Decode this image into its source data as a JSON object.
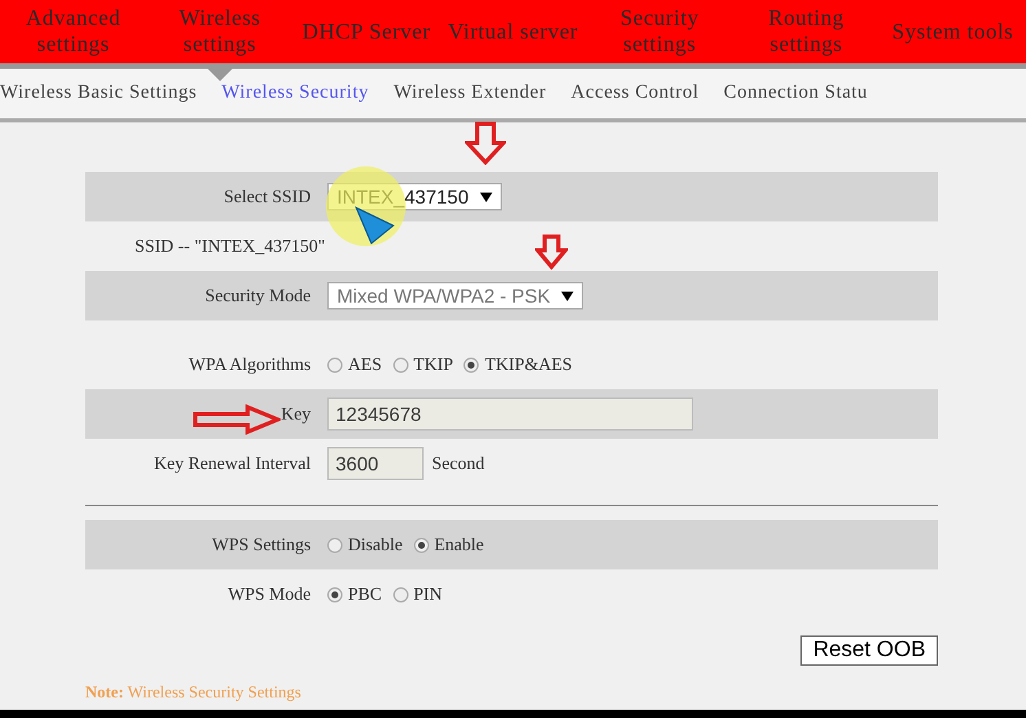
{
  "nav": [
    {
      "label": "Advanced settings",
      "selected": false
    },
    {
      "label": "Wireless settings",
      "selected": true
    },
    {
      "label": "DHCP Server",
      "selected": false
    },
    {
      "label": "Virtual server",
      "selected": false
    },
    {
      "label": "Security settings",
      "selected": false
    },
    {
      "label": "Routing settings",
      "selected": false
    },
    {
      "label": "System tools",
      "selected": false
    }
  ],
  "subnav": [
    {
      "label": "Wireless Basic Settings",
      "selected": false
    },
    {
      "label": "Wireless Security",
      "selected": true
    },
    {
      "label": "Wireless Extender",
      "selected": false
    },
    {
      "label": "Access Control",
      "selected": false
    },
    {
      "label": "Connection Statu",
      "selected": false
    }
  ],
  "form": [
    {
      "kind": "select",
      "label": "Select SSID",
      "value": "INTEX_437150",
      "shaded": true
    },
    {
      "kind": "text",
      "text": "SSID -- \"INTEX_437150\"",
      "shaded": false
    },
    {
      "kind": "select",
      "label": "Security Mode",
      "value": "Mixed WPA/WPA2 - PSK",
      "shaded": true
    },
    {
      "kind": "spacer"
    },
    {
      "kind": "radio",
      "label": "WPA Algorithms",
      "shaded": false,
      "options": [
        {
          "label": "AES",
          "selected": false
        },
        {
          "label": "TKIP",
          "selected": false
        },
        {
          "label": "TKIP&AES",
          "selected": true
        }
      ]
    },
    {
      "kind": "field",
      "label": "Key",
      "value": "12345678",
      "shaded": true
    },
    {
      "kind": "field",
      "label": "Key Renewal Interval",
      "value": "3600",
      "unit": "Second",
      "shaded": false
    },
    {
      "kind": "divider"
    },
    {
      "kind": "radio",
      "label": "WPS Settings",
      "shaded": true,
      "options": [
        {
          "label": "Disable",
          "selected": false
        },
        {
          "label": "Enable",
          "selected": true
        }
      ]
    },
    {
      "kind": "radio",
      "label": "WPS Mode",
      "shaded": false,
      "options": [
        {
          "label": "PBC",
          "selected": true
        },
        {
          "label": "PIN",
          "selected": false
        }
      ]
    }
  ],
  "reset_button": "Reset OOB",
  "note": {
    "label": "Note:",
    "text": "Wireless Security Settings"
  }
}
